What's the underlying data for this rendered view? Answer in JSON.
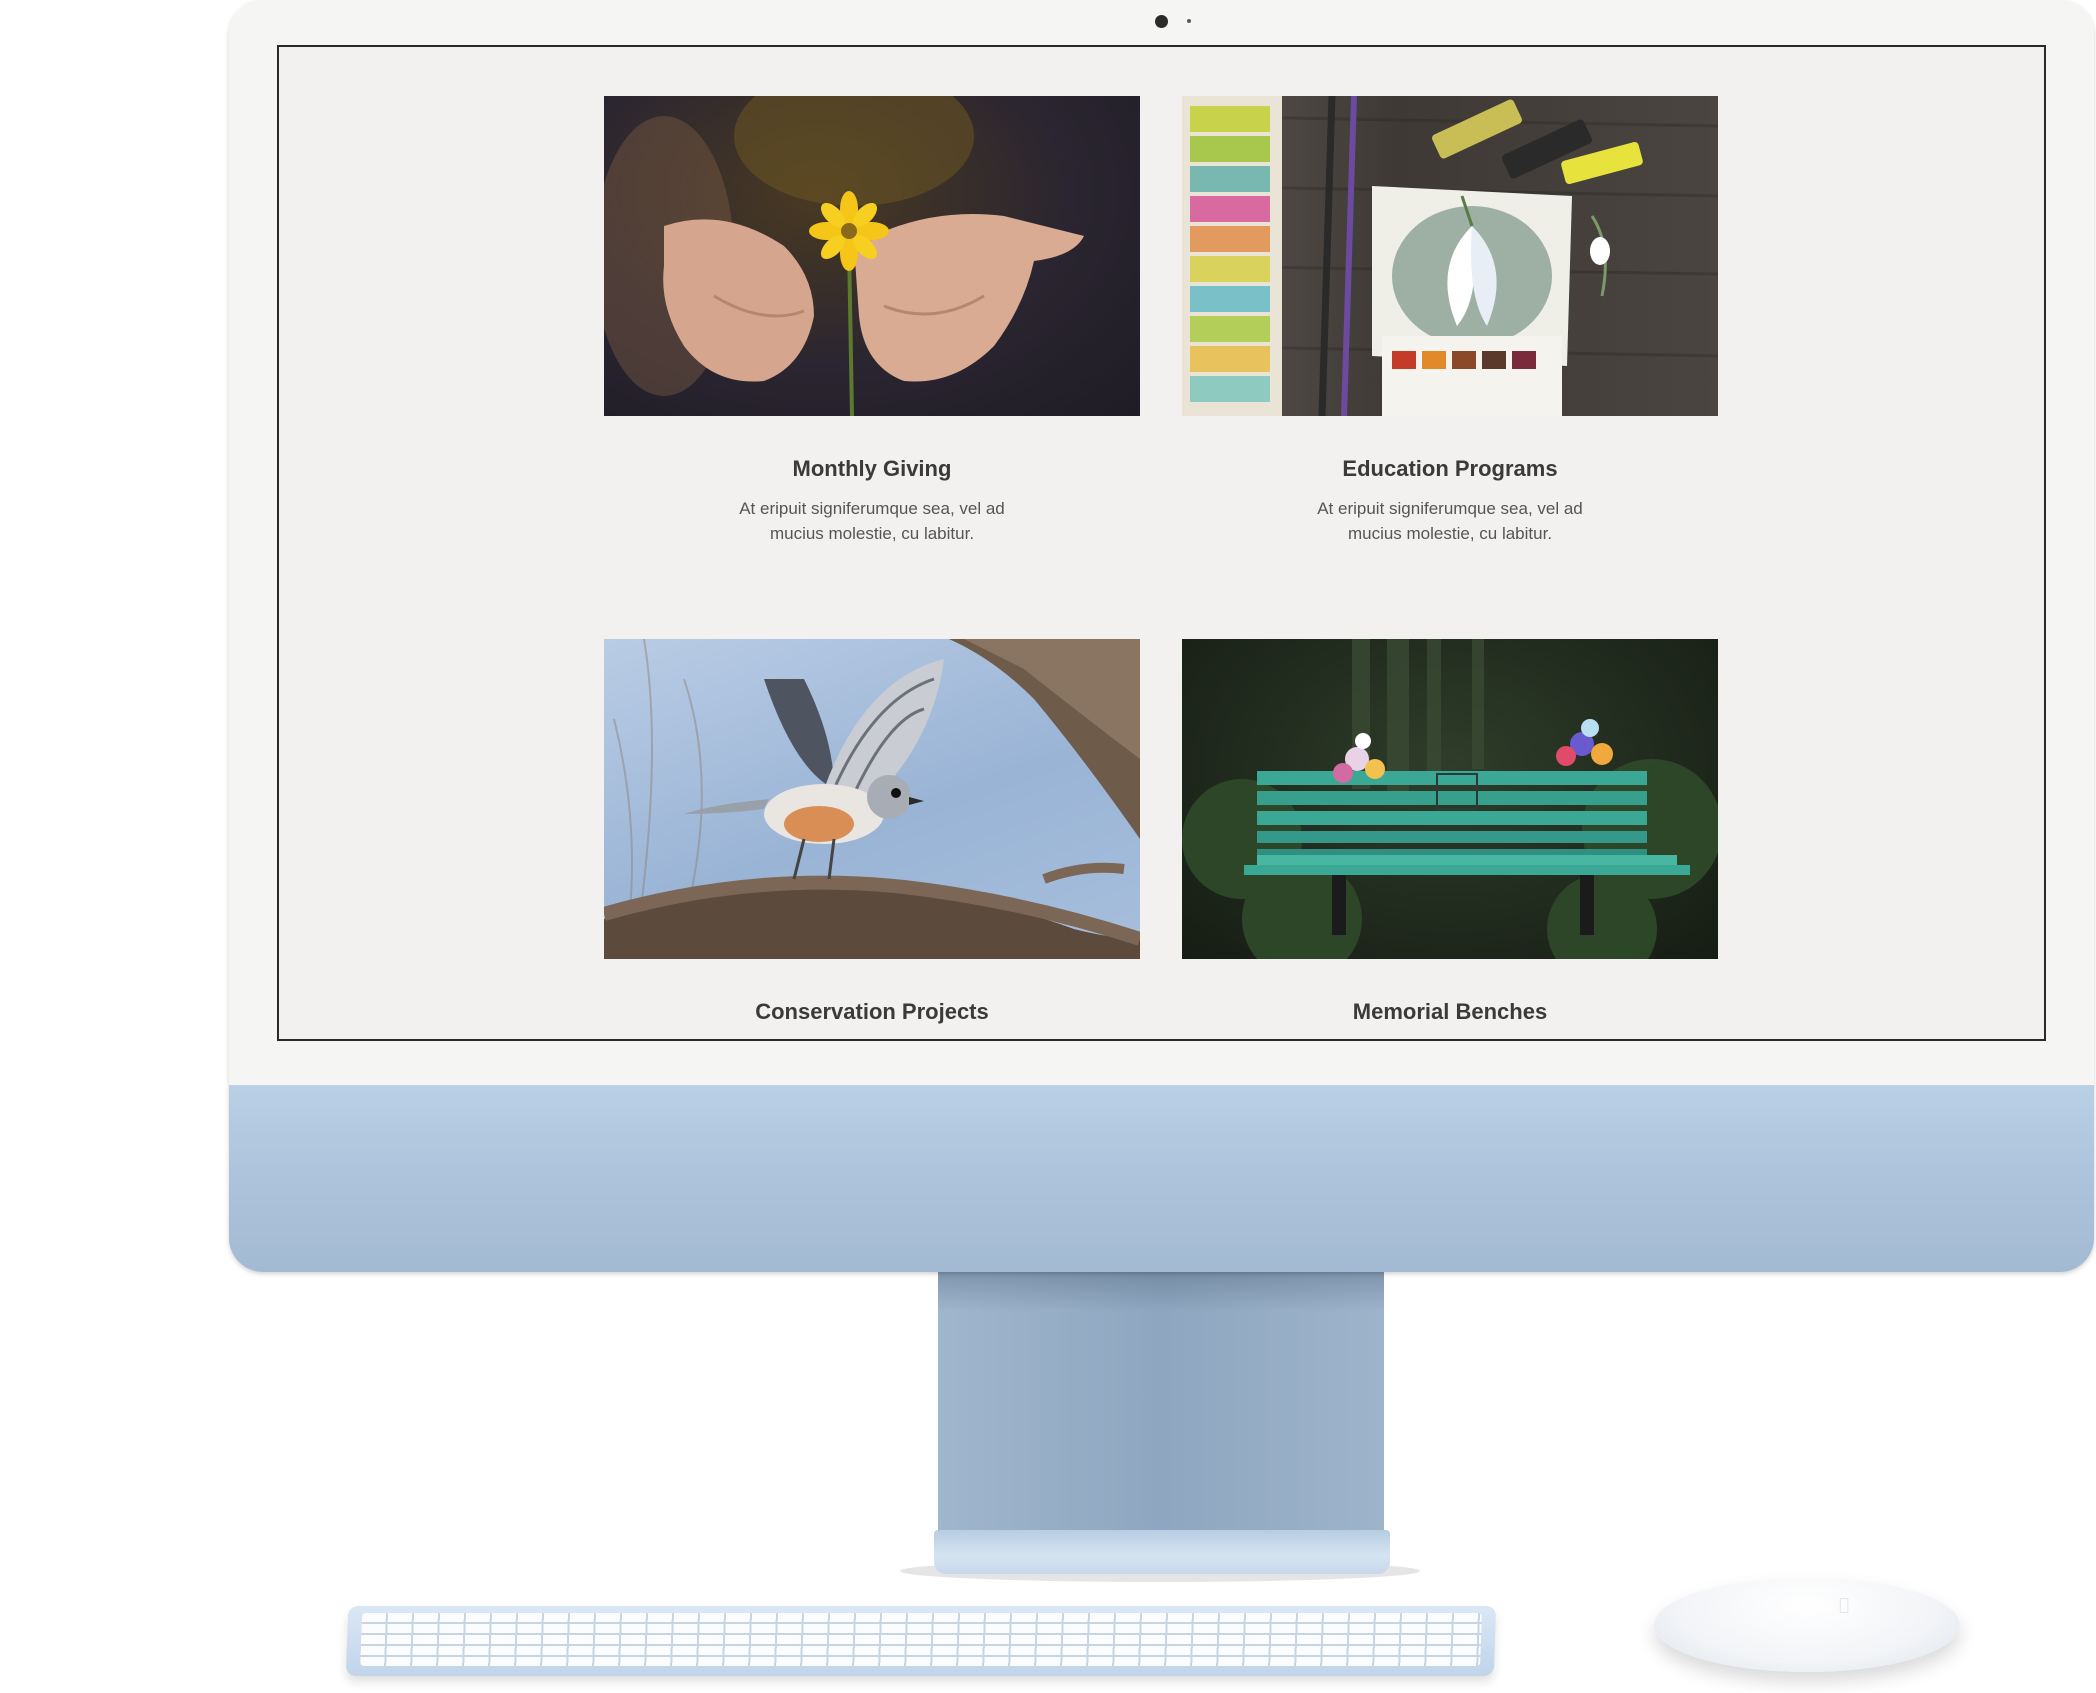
{
  "page": {
    "cards": [
      {
        "title": "Monthly Giving",
        "description": "At eripuit signiferumque sea, vel ad mucius molestie, cu labitur.",
        "image": "hands-holding-flower-photo"
      },
      {
        "title": "Education Programs",
        "description": "At eripuit signiferumque sea, vel ad mucius molestie, cu labitur.",
        "image": "watercolor-painting-photo"
      },
      {
        "title": "Conservation Projects",
        "image": "bird-in-flight-photo"
      },
      {
        "title": "Memorial Benches",
        "image": "memorial-bench-photo"
      }
    ]
  },
  "colors": {
    "page_background": "#f2f1f0",
    "monitor_chin": "#aec4dc",
    "title_text": "#3a3a3a",
    "body_text": "#555555"
  },
  "icons": {
    "camera": "camera-icon",
    "mouse_logo": "apple-logo-icon"
  }
}
